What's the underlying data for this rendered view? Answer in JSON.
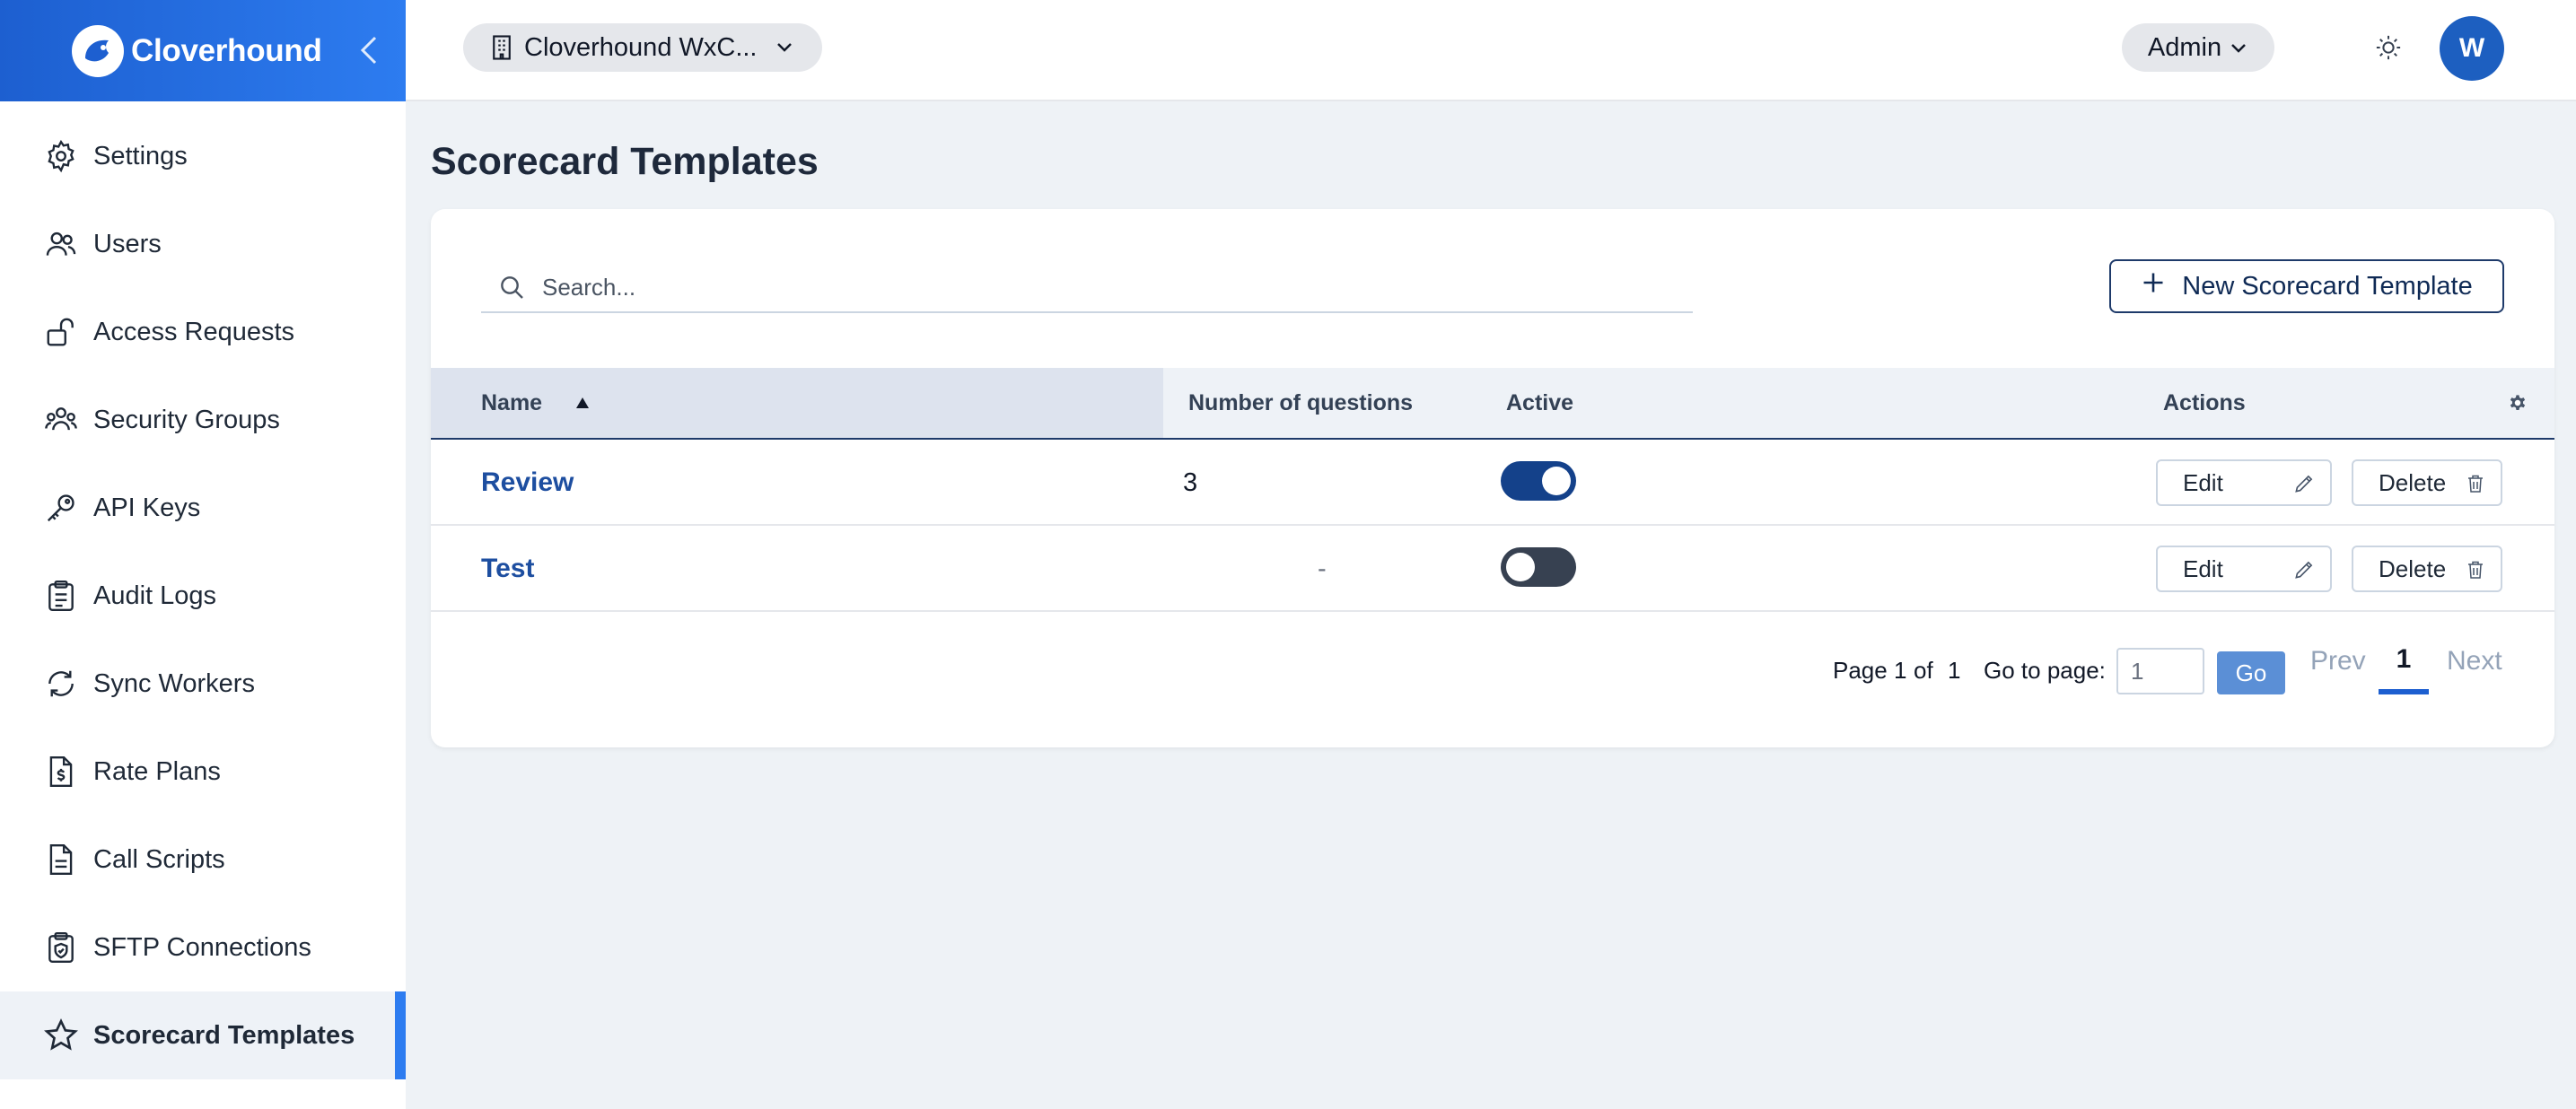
{
  "brand": {
    "name": "Cloverhound"
  },
  "sidebar": {
    "items": [
      {
        "label": "Settings",
        "icon": "gear-icon"
      },
      {
        "label": "Users",
        "icon": "users-icon"
      },
      {
        "label": "Access Requests",
        "icon": "unlock-icon"
      },
      {
        "label": "Security Groups",
        "icon": "group-icon"
      },
      {
        "label": "API Keys",
        "icon": "key-icon"
      },
      {
        "label": "Audit Logs",
        "icon": "clipboard-icon"
      },
      {
        "label": "Sync Workers",
        "icon": "sync-icon"
      },
      {
        "label": "Rate Plans",
        "icon": "dollar-file-icon"
      },
      {
        "label": "Call Scripts",
        "icon": "document-icon"
      },
      {
        "label": "SFTP Connections",
        "icon": "shield-clipboard-icon"
      },
      {
        "label": "Scorecard Templates",
        "icon": "star-icon",
        "active": true
      }
    ]
  },
  "topbar": {
    "org_label": "Cloverhound WxC...",
    "role_label": "Admin",
    "avatar_initial": "W"
  },
  "main": {
    "title": "Scorecard Templates",
    "search_placeholder": "Search...",
    "new_button_label": "New Scorecard Template",
    "columns": {
      "name": "Name",
      "questions": "Number of questions",
      "active": "Active",
      "actions": "Actions"
    },
    "rows": [
      {
        "name": "Review",
        "questions": "3",
        "active": true
      },
      {
        "name": "Test",
        "questions": "-",
        "active": false
      }
    ],
    "edit_label": "Edit",
    "delete_label": "Delete",
    "pager": {
      "page_word": "Page",
      "current": "1",
      "of_word": "of",
      "total": "1",
      "goto_label": "Go to page:",
      "goto_value": "1",
      "go_label": "Go",
      "prev_label": "Prev",
      "page_button": "1",
      "next_label": "Next"
    }
  },
  "colors": {
    "accent": "#2d7cf0",
    "brand_dark": "#1e3a6a",
    "toggle_on": "#14418a",
    "toggle_off": "#374151"
  }
}
